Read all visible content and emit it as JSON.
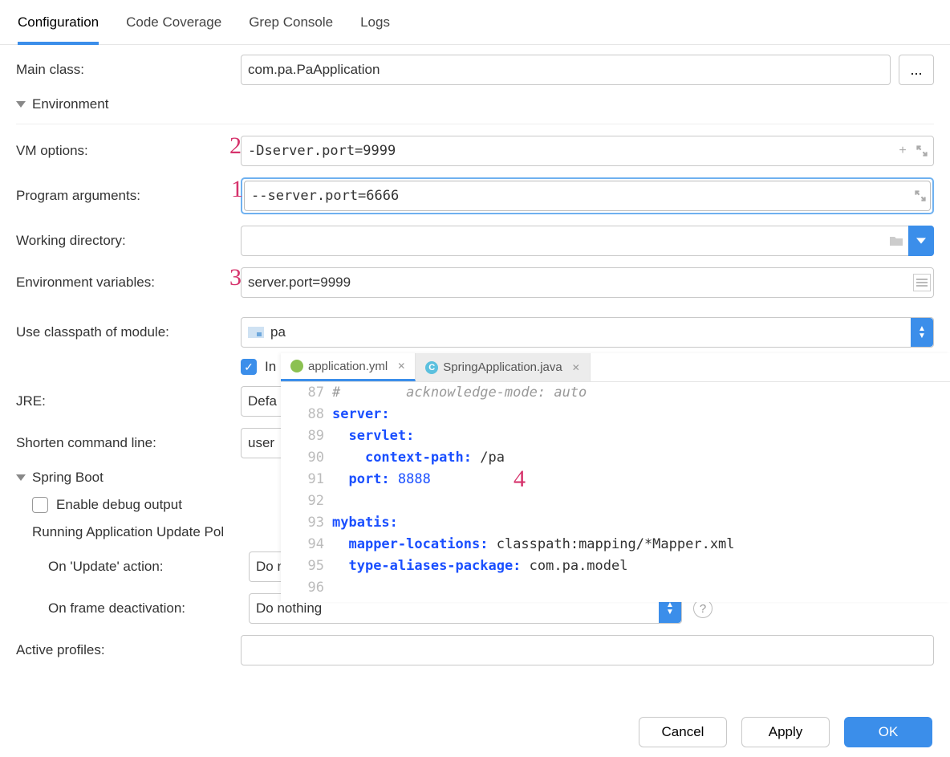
{
  "tabs": [
    "Configuration",
    "Code Coverage",
    "Grep Console",
    "Logs"
  ],
  "activeTab": "Configuration",
  "labels": {
    "mainClass": "Main class:",
    "environment": "Environment",
    "vmOptions": "VM options:",
    "programArgs": "Program arguments:",
    "workingDir": "Working directory:",
    "envVars": "Environment variables:",
    "classpath": "Use classpath of module:",
    "includeCb": "In",
    "jre": "JRE:",
    "shorten": "Shorten command line:",
    "springBoot": "Spring Boot",
    "enableDebug": "Enable debug output",
    "updatePolicies": "Running Application Update Pol",
    "onUpdate": "On 'Update' action:",
    "onFrameDeact": "On frame deactivation:",
    "activeProfiles": "Active profiles:"
  },
  "values": {
    "mainClass": "com.pa.PaApplication",
    "vmOptions": "-Dserver.port=9999",
    "programArgs": "--server.port=6666",
    "workingDir": "",
    "envVars": "server.port=9999",
    "module": "pa",
    "jre": "Defa",
    "shorten": "user",
    "onUpdate": "Do nothing",
    "onFrameDeact": "Do nothing",
    "activeProfiles": ""
  },
  "buttons": {
    "cancel": "Cancel",
    "apply": "Apply",
    "ok": "OK",
    "ellipsis": "..."
  },
  "annotations": {
    "a1": "1",
    "a2": "2",
    "a3": "3",
    "a4": "4"
  },
  "overlay": {
    "fileTabs": [
      {
        "name": "application.yml",
        "type": "yml",
        "active": true
      },
      {
        "name": "SpringApplication.java",
        "type": "java",
        "active": false
      }
    ],
    "gutterStart": 87,
    "fragmentLine": "#        acknowledge-mode: auto",
    "lines": [
      {
        "n": 87,
        "html": ""
      },
      {
        "n": 88,
        "html": "<span class='key'>server:</span>"
      },
      {
        "n": 89,
        "html": "  <span class='key'>servlet:</span>"
      },
      {
        "n": 90,
        "html": "    <span class='key'>context-path:</span> /pa"
      },
      {
        "n": 91,
        "html": "  <span class='key'>port:</span> <span class='num'>8888</span>"
      },
      {
        "n": 92,
        "html": ""
      },
      {
        "n": 93,
        "html": "<span class='key'>mybatis:</span>"
      },
      {
        "n": 94,
        "html": "  <span class='key'>mapper-locations:</span> classpath:mapping/*Mapper.xml"
      },
      {
        "n": 95,
        "html": "  <span class='key'>type-aliases-package:</span> com.pa.model"
      },
      {
        "n": 96,
        "html": ""
      }
    ]
  }
}
